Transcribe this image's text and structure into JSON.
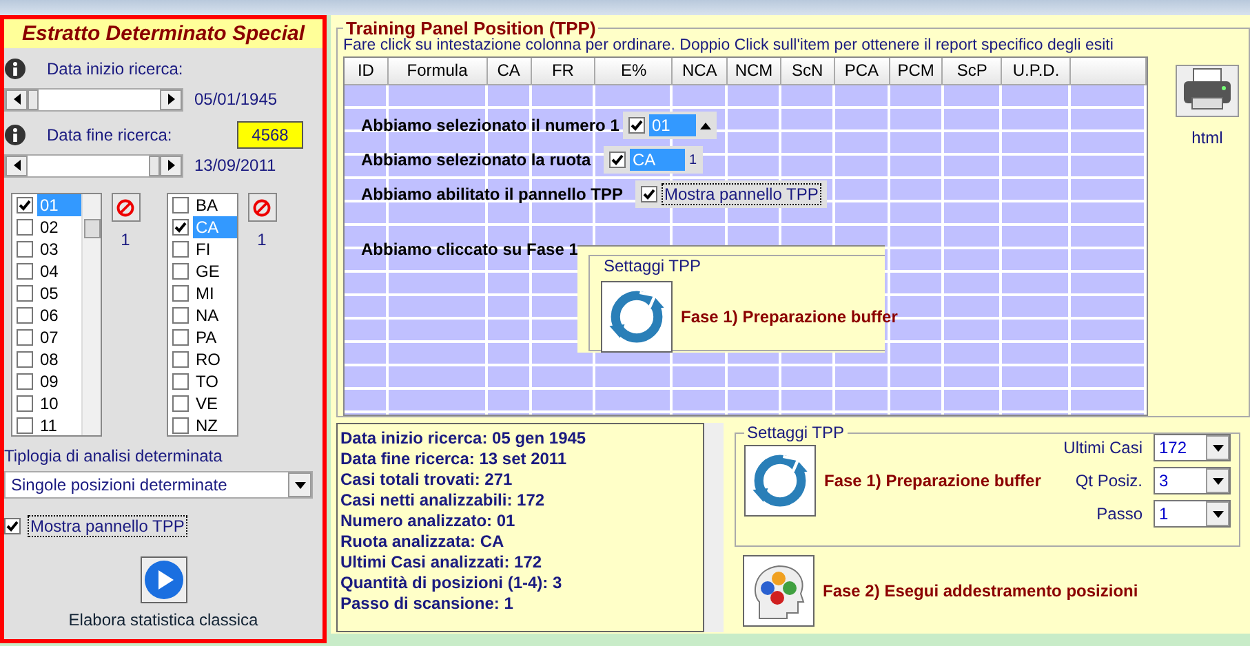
{
  "left_panel": {
    "title": "Estratto Determinato Special",
    "start_date": {
      "label": "Data inizio ricerca:",
      "value": "05/01/1945",
      "level": 0
    },
    "end_date": {
      "label": "Data fine ricerca:",
      "value": "13/09/2011",
      "count": "4568",
      "level": 1
    },
    "numbers": {
      "count": "1",
      "items": [
        {
          "label": "01",
          "checked": true,
          "selected": true
        },
        {
          "label": "02",
          "checked": false,
          "selected": false
        },
        {
          "label": "03",
          "checked": false,
          "selected": false
        },
        {
          "label": "04",
          "checked": false,
          "selected": false
        },
        {
          "label": "05",
          "checked": false,
          "selected": false
        },
        {
          "label": "06",
          "checked": false,
          "selected": false
        },
        {
          "label": "07",
          "checked": false,
          "selected": false
        },
        {
          "label": "08",
          "checked": false,
          "selected": false
        },
        {
          "label": "09",
          "checked": false,
          "selected": false
        },
        {
          "label": "10",
          "checked": false,
          "selected": false
        },
        {
          "label": "11",
          "checked": false,
          "selected": false
        }
      ]
    },
    "wheels": {
      "count": "1",
      "items": [
        {
          "label": "BA",
          "checked": false,
          "selected": false
        },
        {
          "label": "CA",
          "checked": true,
          "selected": true
        },
        {
          "label": "FI",
          "checked": false,
          "selected": false
        },
        {
          "label": "GE",
          "checked": false,
          "selected": false
        },
        {
          "label": "MI",
          "checked": false,
          "selected": false
        },
        {
          "label": "NA",
          "checked": false,
          "selected": false
        },
        {
          "label": "PA",
          "checked": false,
          "selected": false
        },
        {
          "label": "RO",
          "checked": false,
          "selected": false
        },
        {
          "label": "TO",
          "checked": false,
          "selected": false
        },
        {
          "label": "VE",
          "checked": false,
          "selected": false
        },
        {
          "label": "NZ",
          "checked": false,
          "selected": false
        }
      ]
    },
    "analysis_type": {
      "label": "Tiplogia di analisi determinata",
      "value": "Singole posizioni determinate"
    },
    "show_panel": {
      "label": "Mostra pannello TPP",
      "checked": true
    },
    "run_button": {
      "label": "Elabora statistica classica"
    }
  },
  "tpp_panel": {
    "title": "Training Panel Position (TPP)",
    "hint": "Fare click su intestazione colonna per ordinare. Doppio Click sull'item per ottenere il report specifico degli esiti",
    "columns": [
      "ID",
      "Formula",
      "CA",
      "FR",
      "E%",
      "NCA",
      "NCM",
      "ScN",
      "PCA",
      "PCM",
      "ScP",
      "U.P.D."
    ],
    "export": {
      "label": "html"
    },
    "tutorial": [
      {
        "text": "Abbiamo selezionato il numero 1",
        "kind": "number",
        "item": "01",
        "checked": true
      },
      {
        "text": "Abbiamo selezionato la ruota",
        "kind": "wheel",
        "item": "CA",
        "checked": true,
        "count": "1"
      },
      {
        "text": "Abbiamo abilitato il pannello TPP",
        "kind": "checkbox",
        "item": "Mostra pannello TPP",
        "checked": true
      },
      {
        "text": "Abbiamo cliccato su Fase 1",
        "kind": "settings",
        "legend": "Settaggi TPP",
        "item": "Fase 1) Preparazione buffer"
      }
    ],
    "summary": [
      "Data inizio ricerca: 05 gen 1945",
      "Data fine ricerca: 13 set 2011",
      "Casi totali trovati: 271",
      "Casi netti analizzabili: 172",
      "Numero analizzato: 01",
      "Ruota analizzata: CA",
      "Ultimi Casi analizzati: 172",
      "Quantità di posizioni (1-4): 3",
      "Passo di scansione: 1"
    ],
    "settings": {
      "title": "Settaggi TPP",
      "phase1": "Fase 1) Preparazione buffer",
      "fields": [
        {
          "label": "Ultimi Casi",
          "value": "172"
        },
        {
          "label": "Qt Posiz.",
          "value": "3"
        },
        {
          "label": "Passo",
          "value": "1"
        }
      ]
    },
    "phase2": "Fase 2) Esegui addestramento posizioni"
  }
}
